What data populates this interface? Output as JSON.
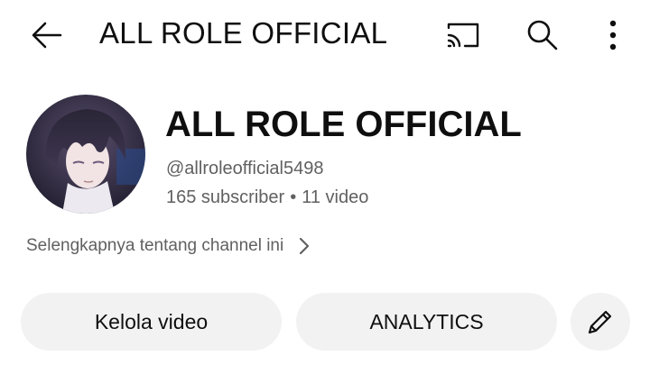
{
  "header": {
    "title": "ALL ROLE OFFICIAL",
    "icons": [
      "arrow-left-icon",
      "cast-icon",
      "search-icon",
      "more-vert-icon"
    ]
  },
  "channel": {
    "name": "ALL ROLE OFFICIAL",
    "handle": "@allroleofficial5498",
    "subscribers": "165 subscriber",
    "separator": "•",
    "videos": "11 video",
    "more_about": "Selengkapnya tentang channel ini"
  },
  "actions": {
    "manage_videos": "Kelola video",
    "analytics": "ANALYTICS",
    "edit_icon": "pencil-icon"
  },
  "colors": {
    "text_primary": "#0f0f0f",
    "text_secondary": "#606060",
    "pill_bg": "#f2f2f2"
  }
}
